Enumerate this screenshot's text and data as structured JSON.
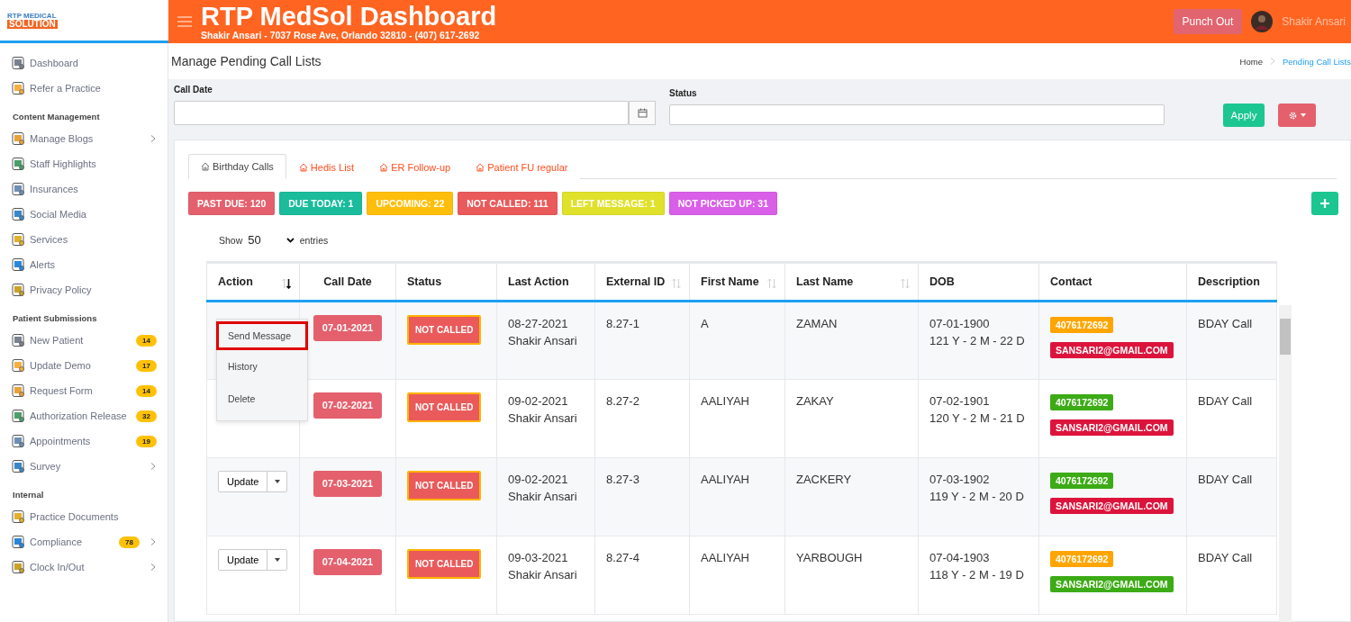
{
  "logo": {
    "line1": "RTP MEDICAL",
    "line2": "SOLUTION"
  },
  "header": {
    "title": "RTP MedSol Dashboard",
    "subtitle": "Shakir Ansari - 7037 Rose Ave, Orlando 32810 - (407) 617-2692",
    "punch_button": "Punch Out",
    "user": "Shakir Ansari"
  },
  "sidebar": [
    {
      "kind": "item",
      "label": "Dashboard"
    },
    {
      "kind": "item",
      "label": "Refer a Practice"
    },
    {
      "kind": "heading",
      "label": "Content Management"
    },
    {
      "kind": "item",
      "label": "Manage Blogs",
      "has_submenu": true
    },
    {
      "kind": "item",
      "label": "Staff Highlights"
    },
    {
      "kind": "item",
      "label": "Insurances"
    },
    {
      "kind": "item",
      "label": "Social Media"
    },
    {
      "kind": "item",
      "label": "Services"
    },
    {
      "kind": "item",
      "label": "Alerts"
    },
    {
      "kind": "item",
      "label": "Privacy Policy"
    },
    {
      "kind": "heading",
      "label": "Patient Submissions"
    },
    {
      "kind": "item",
      "label": "New Patient",
      "badge": "14"
    },
    {
      "kind": "item",
      "label": "Update Demo",
      "badge": "17"
    },
    {
      "kind": "item",
      "label": "Request Form",
      "badge": "14"
    },
    {
      "kind": "item",
      "label": "Authorization Release",
      "badge": "32"
    },
    {
      "kind": "item",
      "label": "Appointments",
      "badge": "19"
    },
    {
      "kind": "item",
      "label": "Survey",
      "has_submenu": true
    },
    {
      "kind": "heading",
      "label": "Internal"
    },
    {
      "kind": "item",
      "label": "Practice Documents"
    },
    {
      "kind": "item",
      "label": "Compliance",
      "badge": "78",
      "has_submenu": true
    },
    {
      "kind": "item",
      "label": "Clock In/Out",
      "has_submenu": true
    }
  ],
  "page_title": "Manage Pending Call Lists",
  "breadcrumb": [
    {
      "label": "Home",
      "selected": false
    },
    {
      "label": "Pending Call Lists",
      "selected": true
    }
  ],
  "filters": {
    "call_date_label": "Call Date",
    "status_label": "Status",
    "apply_button": "Apply"
  },
  "tabs": [
    {
      "label": "Birthday Calls",
      "selected": true
    },
    {
      "label": "Hedis List",
      "selected": false
    },
    {
      "label": "ER Follow-up",
      "selected": false
    },
    {
      "label": "Patient FU regular",
      "selected": false
    }
  ],
  "counters": [
    {
      "label": "PAST DUE: 120",
      "color": "#e4606d"
    },
    {
      "label": "DUE TODAY: 1",
      "color": "#1abc9c"
    },
    {
      "label": "UPCOMING: 22",
      "color": "#ffbe0b"
    },
    {
      "label": "NOT CALLED: 111",
      "color": "#ea5a5a"
    },
    {
      "label": "LEFT MESSAGE: 1",
      "color": "#e0e12a"
    },
    {
      "label": "NOT PICKED UP: 31",
      "color": "#d95fe8"
    }
  ],
  "entries": {
    "show": "Show",
    "value": "50",
    "suffix": "entries"
  },
  "table": {
    "columns": [
      {
        "label": "Action",
        "sortable": true,
        "sorted": true
      },
      {
        "label": "Call Date",
        "sortable": false
      },
      {
        "label": "Status",
        "sortable": false
      },
      {
        "label": "Last Action",
        "sortable": false
      },
      {
        "label": "External ID",
        "sortable": true,
        "sorted": false
      },
      {
        "label": "First Name",
        "sortable": true,
        "sorted": false
      },
      {
        "label": "Last Name",
        "sortable": true,
        "sorted": false
      },
      {
        "label": "DOB",
        "sortable": false
      },
      {
        "label": "Contact",
        "sortable": false
      },
      {
        "label": "Description",
        "sortable": false
      }
    ],
    "rows": [
      {
        "call_date": "07-01-2021",
        "status": "NOT CALLED",
        "last_action": [
          "08-27-2021",
          "Shakir Ansari"
        ],
        "external_id": "8.27-1",
        "first_name": "A",
        "last_name": "ZAMAN",
        "dob": [
          "07-01-1900",
          "121 Y - 2 M - 22 D"
        ],
        "phone": {
          "text": "4076172692",
          "color": "#ffa500"
        },
        "email": {
          "text": "SANSARI2@GMAIL.COM",
          "color": "#dc143c"
        },
        "description": "BDAY Call"
      },
      {
        "call_date": "07-02-2021",
        "status": "NOT CALLED",
        "last_action": [
          "09-02-2021",
          "Shakir Ansari"
        ],
        "external_id": "8.27-2",
        "first_name": "AALIYAH",
        "last_name": "ZAKAY",
        "dob": [
          "07-02-1901",
          "120 Y - 2 M - 21 D"
        ],
        "phone": {
          "text": "4076172692",
          "color": "#3cab16"
        },
        "email": {
          "text": "SANSARI2@GMAIL.COM",
          "color": "#dc143c"
        },
        "description": "BDAY Call"
      },
      {
        "action": "Update",
        "call_date": "07-03-2021",
        "status": "NOT CALLED",
        "last_action": [
          "09-02-2021",
          "Shakir Ansari"
        ],
        "external_id": "8.27-3",
        "first_name": "AALIYAH",
        "last_name": "ZACKERY",
        "dob": [
          "07-03-1902",
          "119 Y - 2 M - 20 D"
        ],
        "phone": {
          "text": "4076172692",
          "color": "#3cab16"
        },
        "email": {
          "text": "SANSARI2@GMAIL.COM",
          "color": "#dc143c"
        },
        "description": "BDAY Call"
      },
      {
        "action": "Update",
        "call_date": "07-04-2021",
        "status": "NOT CALLED",
        "last_action": [
          "09-03-2021",
          "Shakir Ansari"
        ],
        "external_id": "8.27-4",
        "first_name": "AALIYAH",
        "last_name": "YARBOUGH",
        "dob": [
          "07-04-1903",
          "118 Y - 2 M - 19 D"
        ],
        "phone": {
          "text": "4076172692",
          "color": "#ffa500"
        },
        "email": {
          "text": "SANSARI2@GMAIL.COM",
          "color": "#3cab16"
        },
        "description": "BDAY Call"
      }
    ]
  },
  "action_menu": [
    {
      "label": "Send Message",
      "selected": true
    },
    {
      "label": "History",
      "selected": false
    },
    {
      "label": "Delete",
      "selected": false
    }
  ]
}
